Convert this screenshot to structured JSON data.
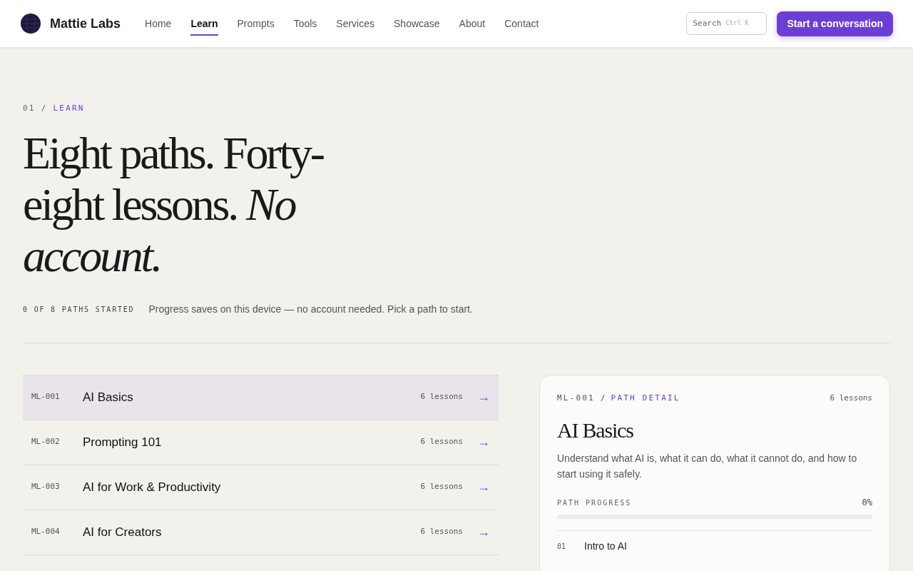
{
  "brand": {
    "name": "Mattie Labs"
  },
  "nav": [
    {
      "label": "Home",
      "selected": false
    },
    {
      "label": "Learn",
      "selected": true
    },
    {
      "label": "Prompts",
      "selected": false
    },
    {
      "label": "Tools",
      "selected": false
    },
    {
      "label": "Services",
      "selected": false
    },
    {
      "label": "Showcase",
      "selected": false
    },
    {
      "label": "About",
      "selected": false
    },
    {
      "label": "Contact",
      "selected": false
    }
  ],
  "search": {
    "placeholder": "Search",
    "shortcut": "Ctrl K"
  },
  "cta": "Start a conversation",
  "eyebrow": {
    "number": "01",
    "separator": "/",
    "section": "LEARN"
  },
  "headline": "Eight paths. Forty-eight lessons. *No account.*",
  "progress_summary": {
    "count": "0 OF 8 PATHS STARTED",
    "note": "Progress saves on this device — no account needed. Pick a path to start."
  },
  "paths": [
    {
      "code": "ML-001",
      "title": "AI Basics",
      "lessons": "6 lessons",
      "arrow": "→",
      "selected": true
    },
    {
      "code": "ML-002",
      "title": "Prompting 101",
      "lessons": "6 lessons",
      "arrow": "→",
      "selected": false
    },
    {
      "code": "ML-003",
      "title": "AI for Work & Productivity",
      "lessons": "6 lessons",
      "arrow": "→",
      "selected": false
    },
    {
      "code": "ML-004",
      "title": "AI for Creators",
      "lessons": "6 lessons",
      "arrow": "→",
      "selected": false
    }
  ],
  "detail": {
    "code": "ML-001",
    "separator": "/",
    "label": "PATH DETAIL",
    "lessons": "6 lessons",
    "title": "AI Basics",
    "description": "Understand what AI is, what it can do, what it cannot do, and how to start using it safely.",
    "progress_label": "PATH PROGRESS",
    "progress_value": "0%",
    "level": 0,
    "lessons_list": [
      {
        "number": "01",
        "title": "Intro to AI"
      }
    ]
  }
}
